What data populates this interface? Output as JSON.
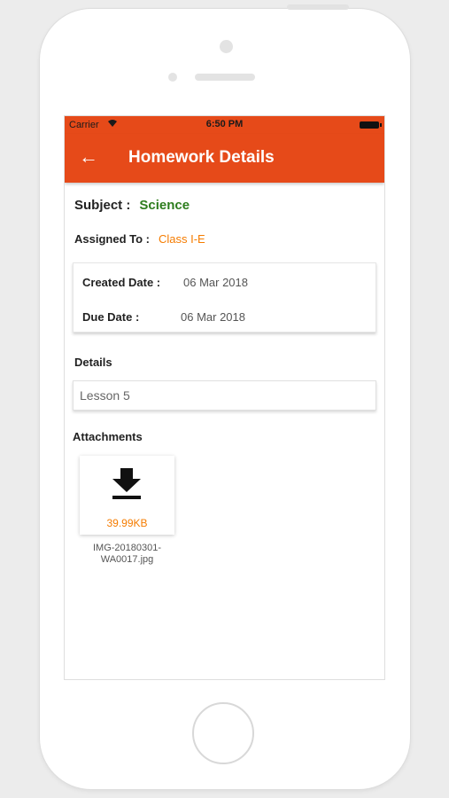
{
  "status_bar": {
    "carrier": "Carrier",
    "wifi": "◉",
    "time": "6:50 PM"
  },
  "app_bar": {
    "back_icon": "←",
    "title": "Homework Details"
  },
  "subject": {
    "label": "Subject :",
    "value": "Science"
  },
  "assigned": {
    "label": "Assigned To :",
    "value": "Class I-E"
  },
  "dates": {
    "created_label": "Created Date :",
    "created_value": "06 Mar 2018",
    "due_label": "Due Date :",
    "due_value": "06 Mar 2018"
  },
  "details": {
    "label": "Details",
    "value": "Lesson 5"
  },
  "attachments": {
    "label": "Attachments",
    "items": [
      {
        "icon": "download-icon",
        "size": "39.99KB",
        "name_line1": "IMG-20180301-",
        "name_line2": "WA0017.jpg"
      }
    ]
  },
  "colors": {
    "accent": "#e64a19",
    "subject_value": "#2e7d1e",
    "highlight": "#f57c00"
  }
}
